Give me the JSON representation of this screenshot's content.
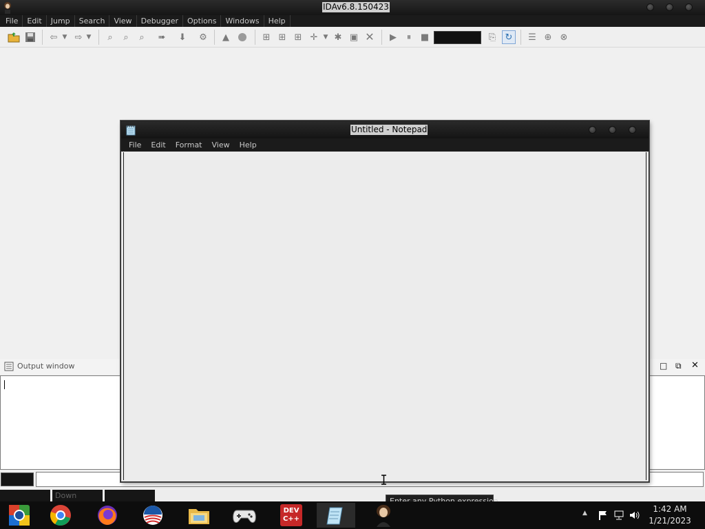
{
  "ida": {
    "title": "IDAv6.8.150423",
    "menu": [
      "File",
      "Edit",
      "Jump",
      "Search",
      "View",
      "Debugger",
      "Options",
      "Windows",
      "Help"
    ]
  },
  "output_window": {
    "title": "Output window"
  },
  "status_bar": {
    "state": "Down"
  },
  "notepad": {
    "title": "Untitled - Notepad",
    "menu": [
      "File",
      "Edit",
      "Format",
      "View",
      "Help"
    ],
    "content": ""
  },
  "tooltip": {
    "text": "Enter any Python expression"
  },
  "taskbar": {
    "apps": [
      "start-button",
      "chrome",
      "firefox",
      "obama-logo-app",
      "file-explorer",
      "game-controller",
      "dev-cpp",
      "notepad",
      "ida"
    ],
    "dev_label_top": "DEV",
    "dev_label_bottom": "C++",
    "clock_time": "1:42 AM",
    "clock_date": "1/21/2023"
  }
}
